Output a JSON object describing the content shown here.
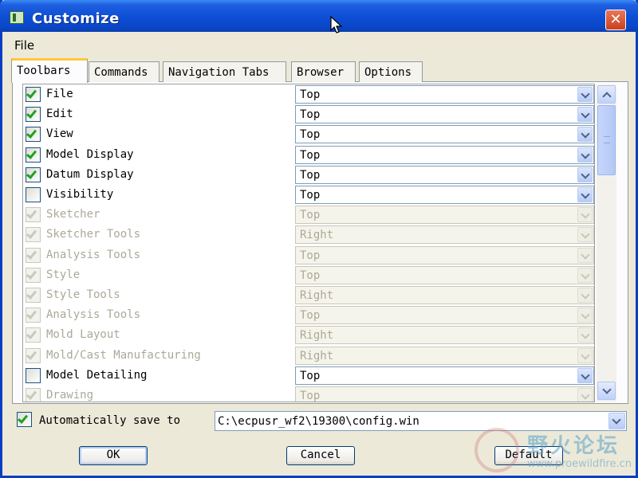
{
  "window": {
    "title": "Customize",
    "close_glyph": "✕"
  },
  "menu": {
    "file_label": "File"
  },
  "tabs": [
    {
      "label": "Toolbars",
      "active": true
    },
    {
      "label": "Commands",
      "active": false
    },
    {
      "label": "Navigation Tabs",
      "active": false
    },
    {
      "label": "Browser",
      "active": false
    },
    {
      "label": "Options",
      "active": false
    }
  ],
  "toolbars": [
    {
      "name": "File",
      "checked": true,
      "enabled": true,
      "position": "Top"
    },
    {
      "name": "Edit",
      "checked": true,
      "enabled": true,
      "position": "Top"
    },
    {
      "name": "View",
      "checked": true,
      "enabled": true,
      "position": "Top"
    },
    {
      "name": "Model Display",
      "checked": true,
      "enabled": true,
      "position": "Top"
    },
    {
      "name": "Datum Display",
      "checked": true,
      "enabled": true,
      "position": "Top"
    },
    {
      "name": "Visibility",
      "checked": false,
      "enabled": true,
      "position": "Top"
    },
    {
      "name": "Sketcher",
      "checked": true,
      "enabled": false,
      "position": "Top"
    },
    {
      "name": "Sketcher Tools",
      "checked": true,
      "enabled": false,
      "position": "Right"
    },
    {
      "name": "Analysis Tools",
      "checked": true,
      "enabled": false,
      "position": "Top"
    },
    {
      "name": "Style",
      "checked": true,
      "enabled": false,
      "position": "Top"
    },
    {
      "name": "Style Tools",
      "checked": true,
      "enabled": false,
      "position": "Right"
    },
    {
      "name": "Analysis Tools",
      "checked": true,
      "enabled": false,
      "position": "Top"
    },
    {
      "name": "Mold Layout",
      "checked": true,
      "enabled": false,
      "position": "Right"
    },
    {
      "name": "Mold/Cast Manufacturing",
      "checked": true,
      "enabled": false,
      "position": "Right"
    },
    {
      "name": "Model Detailing",
      "checked": false,
      "enabled": true,
      "position": "Top"
    },
    {
      "name": "Drawing",
      "checked": true,
      "enabled": false,
      "position": "Top"
    }
  ],
  "autosave": {
    "checked": true,
    "label": "Automatically save to",
    "path": "C:\\ecpusr_wf2\\19300\\config.win"
  },
  "buttons": {
    "ok": "OK",
    "cancel": "Cancel",
    "default": "Default"
  },
  "watermark": {
    "text_cn": "野火论坛",
    "url": "www.proewildfire.cn"
  },
  "colors": {
    "title_bar": "#0a46c8",
    "check": "#21a121",
    "disabled_text": "#aca899",
    "active_tab_accent": "#ffc83c"
  }
}
